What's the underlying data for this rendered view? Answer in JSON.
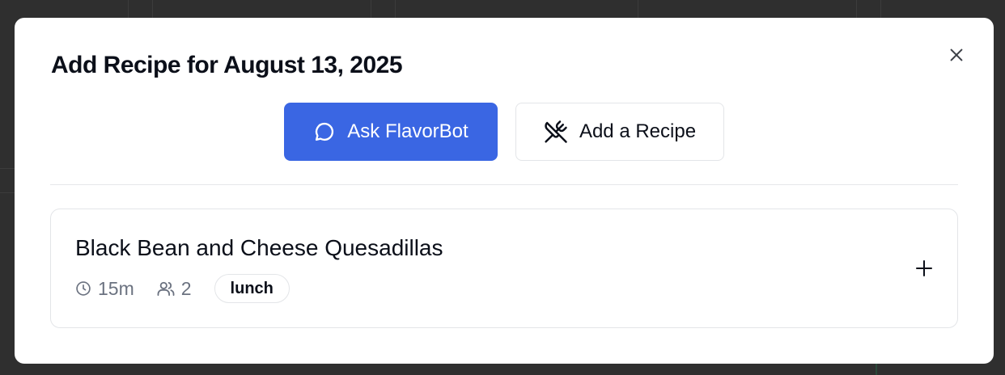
{
  "modal": {
    "title": "Add Recipe for August 13, 2025",
    "close_icon": "close-icon"
  },
  "actions": {
    "ask_label": "Ask FlavorBot",
    "ask_icon": "chat-bubble-icon",
    "ask_color": "#3a66e3",
    "add_label": "Add a Recipe",
    "add_icon": "utensils-crossed-icon"
  },
  "recipes": [
    {
      "title": "Black Bean and Cheese Quesadillas",
      "time": "15m",
      "time_icon": "clock-icon",
      "servings": "2",
      "servings_icon": "users-icon",
      "tag": "lunch",
      "add_icon": "plus-icon"
    }
  ]
}
